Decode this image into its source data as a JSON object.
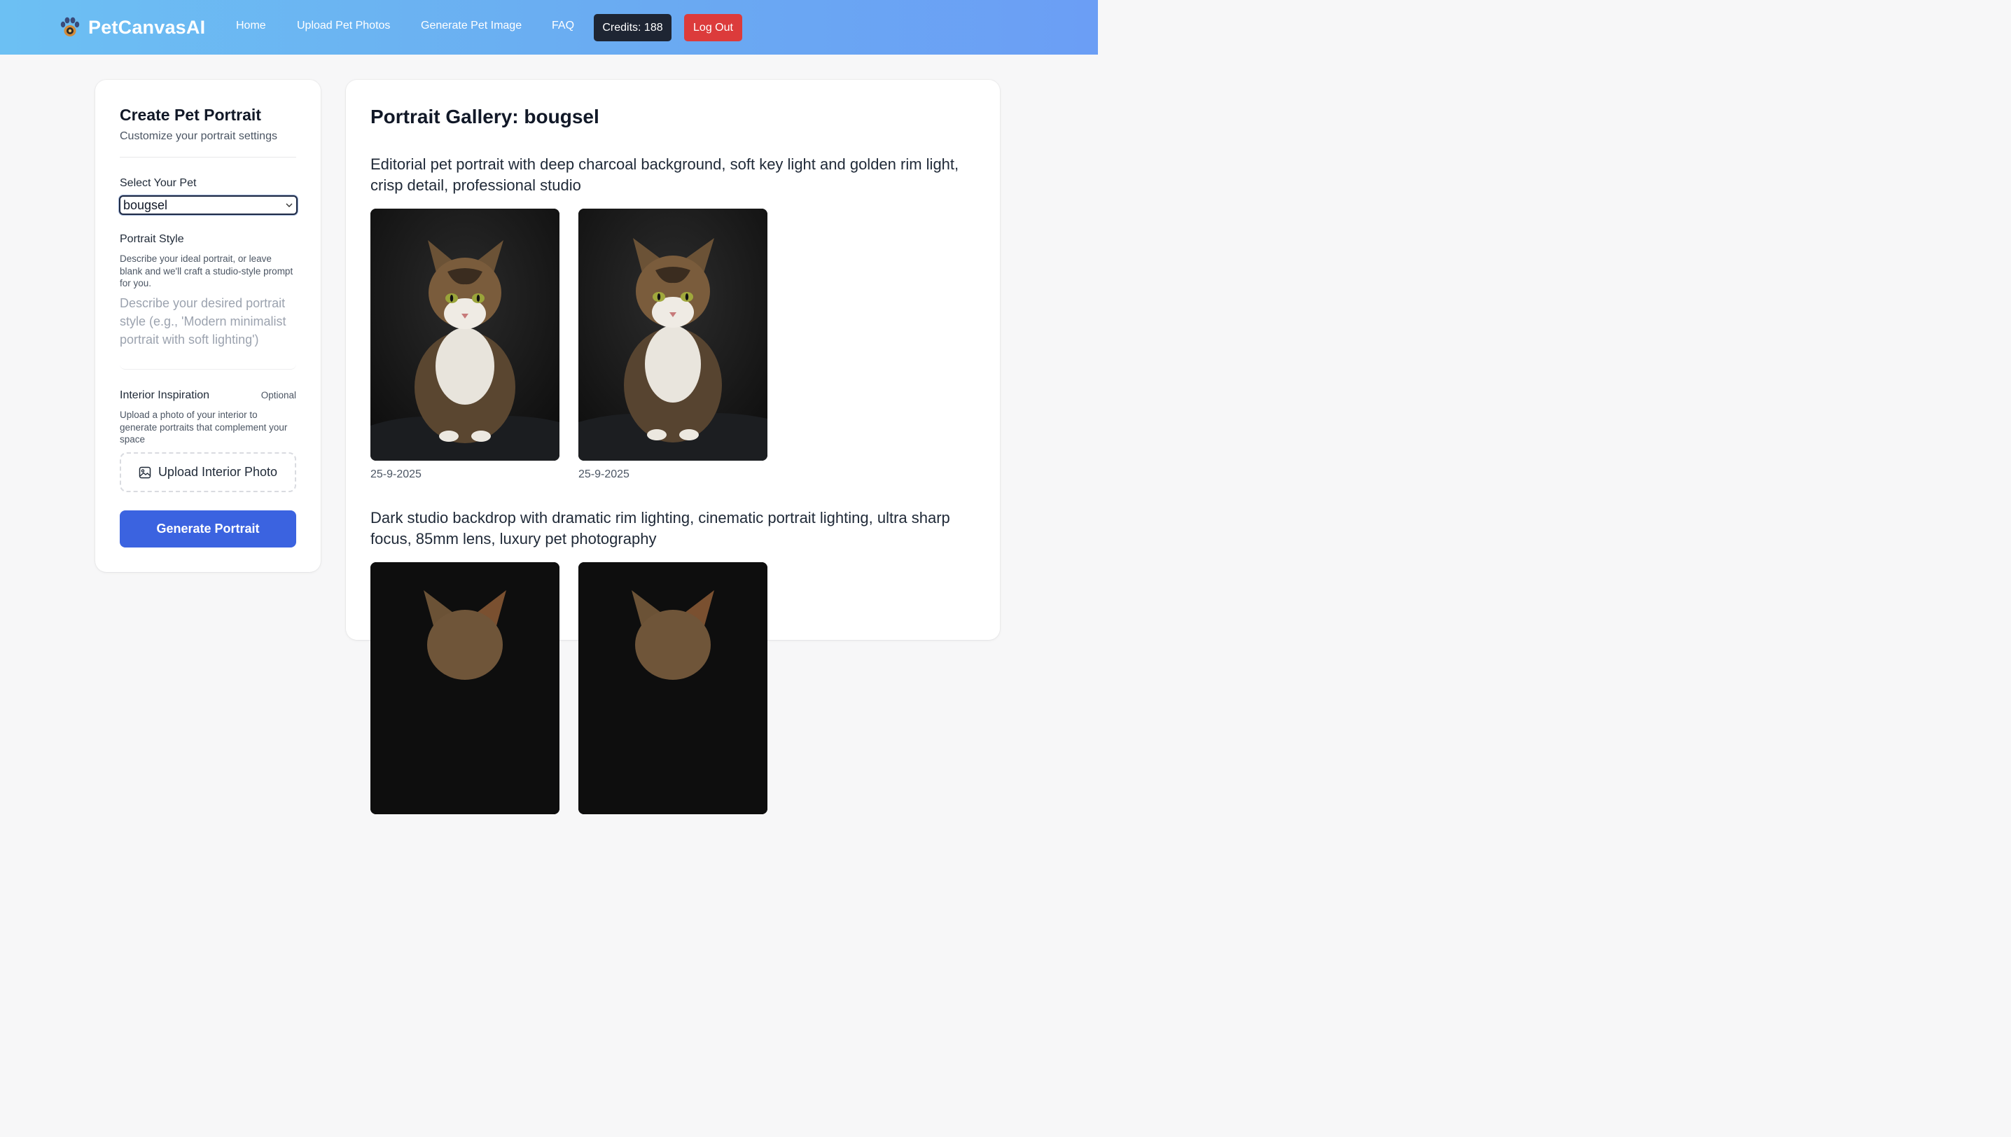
{
  "nav": {
    "brand": "PetCanvasAI",
    "links": [
      "Home",
      "Upload Pet Photos",
      "Generate Pet Image",
      "FAQ"
    ],
    "credits_label": "Credits: 188",
    "logout_label": "Log Out"
  },
  "form": {
    "title": "Create Pet Portrait",
    "subtitle": "Customize your portrait settings",
    "pet_label": "Select Your Pet",
    "pet_selected": "bougsel",
    "style_label": "Portrait Style",
    "style_help": "Describe your ideal portrait, or leave blank and we'll craft a studio-style prompt for you.",
    "style_placeholder": "Describe your desired portrait style (e.g., 'Modern minimalist portrait with soft lighting')",
    "interior_label": "Interior Inspiration",
    "interior_optional": "Optional",
    "interior_help": "Upload a photo of your interior to generate portraits that complement your space",
    "upload_label": "Upload Interior Photo",
    "generate_label": "Generate Portrait"
  },
  "gallery": {
    "title": "Portrait Gallery: bougsel",
    "groups": [
      {
        "prompt": "Editorial pet portrait with deep charcoal background, soft key light and golden rim light, crisp detail, professional studio",
        "images": [
          {
            "date": "25-9-2025",
            "icon": "cat-portrait-image"
          },
          {
            "date": "25-9-2025",
            "icon": "cat-portrait-image"
          }
        ]
      },
      {
        "prompt": "Dark studio backdrop with dramatic rim lighting, cinematic portrait lighting, ultra sharp focus, 85mm lens, luxury pet photography",
        "images": [
          {
            "icon": "cat-portrait-image"
          },
          {
            "icon": "cat-portrait-image"
          }
        ]
      }
    ]
  },
  "colors": {
    "nav_gradient_start": "#6cc0f3",
    "nav_gradient_end": "#6b9ef5",
    "credits_bg": "#1e2533",
    "logout_bg": "#dc3b3b",
    "primary": "#3b63e0"
  }
}
